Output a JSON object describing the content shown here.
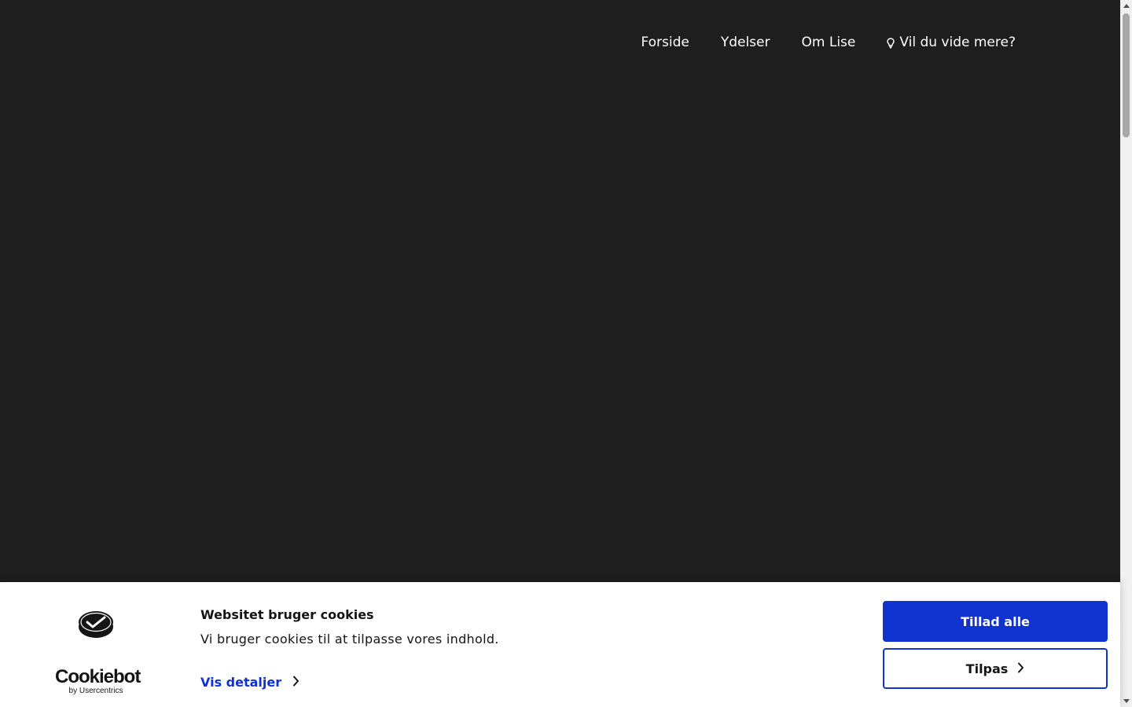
{
  "nav": {
    "items": [
      {
        "label": "Forside"
      },
      {
        "label": "Ydelser"
      },
      {
        "label": "Om Lise"
      },
      {
        "label": "Vil du vide mere?",
        "icon": "lightbulb-icon"
      }
    ]
  },
  "cookie_banner": {
    "logo": {
      "wordmark": "Cookiebot",
      "sub": "by Usercentrics"
    },
    "title": "Websitet bruger cookies",
    "text": "Vi bruger cookies til at tilpasse vores indhold.",
    "details_label": "Vis detaljer",
    "allow_all_label": "Tillad alle",
    "customize_label": "Tilpas"
  },
  "colors": {
    "page_background": "#1e1e1e",
    "accent": "#1032cf",
    "banner_background": "#ffffff",
    "text_dark": "#141414"
  }
}
